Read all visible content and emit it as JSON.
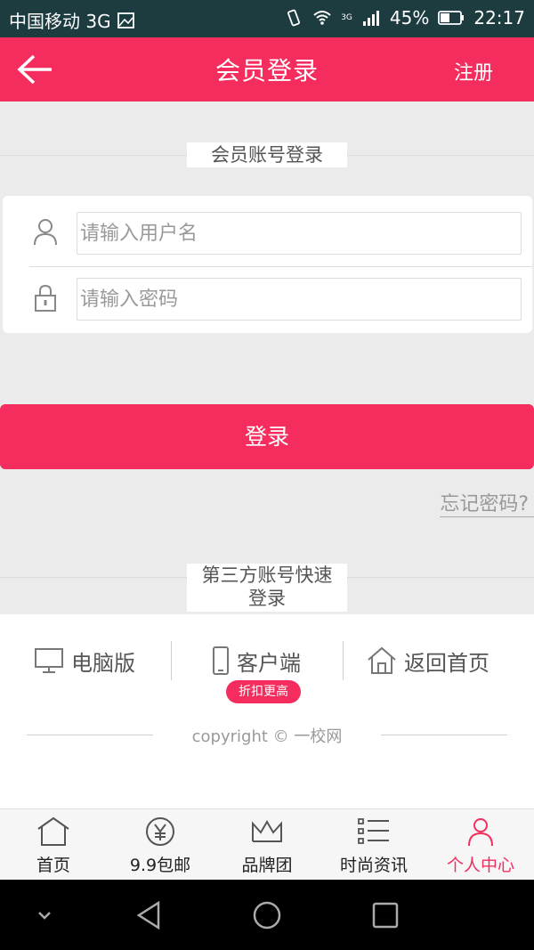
{
  "status_bar": {
    "carrier": "中国移动 3G",
    "network": "3G",
    "battery": "45%",
    "time": "22:17"
  },
  "header": {
    "title": "会员登录",
    "register_label": "注册"
  },
  "member_login_title": "会员账号登录",
  "form": {
    "username_placeholder": "请输入用户名",
    "password_placeholder": "请输入密码",
    "username_value": "",
    "password_value": ""
  },
  "login_button_label": "登录",
  "forgot_password_label": "忘记密码?",
  "third_party": {
    "title_line1": "第三方账号快速",
    "title_line2": "登录"
  },
  "links": [
    {
      "label": "电脑版",
      "icon": "monitor-icon"
    },
    {
      "label": "客户端",
      "icon": "phone-icon"
    },
    {
      "label": "返回首页",
      "icon": "home-icon"
    }
  ],
  "badge": "折扣更高",
  "copyright": "copyright © 一校网",
  "tabs": [
    {
      "label": "首页",
      "icon": "home-icon",
      "active": false
    },
    {
      "label": "9.9包邮",
      "icon": "yen-icon",
      "active": false
    },
    {
      "label": "品牌团",
      "icon": "crown-icon",
      "active": false
    },
    {
      "label": "时尚资讯",
      "icon": "list-icon",
      "active": false
    },
    {
      "label": "个人中心",
      "icon": "person-icon",
      "active": true
    }
  ],
  "colors": {
    "accent": "#f52d5e",
    "status_bar": "#1d3c40",
    "background": "#ebebeb"
  }
}
